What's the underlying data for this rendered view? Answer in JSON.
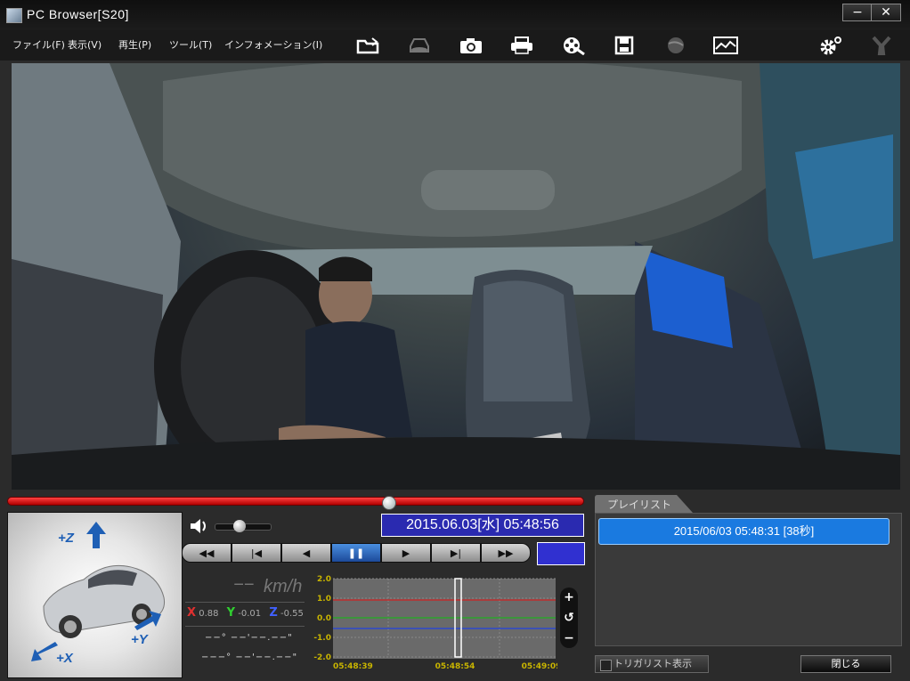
{
  "window": {
    "title": "PC Browser[S20]",
    "minimize_glyph": "−",
    "close_glyph": "✕"
  },
  "menu": [
    {
      "label": "ファイル(F)"
    },
    {
      "label": "表示(V)"
    },
    {
      "label": "再生(P)"
    },
    {
      "label": "ツール(T)"
    },
    {
      "label": "インフォメーション(I)"
    }
  ],
  "toolbar": {
    "icons": [
      "open-folder-icon",
      "disk-disabled-icon",
      "camera-icon",
      "print-icon",
      "film-search-icon",
      "save-icon",
      "globe-disabled-icon",
      "graph-export-icon",
      "settings-gear-icon",
      "tool-disabled-icon"
    ]
  },
  "sensor": {
    "z_label": "+Z",
    "y_label": "+Y",
    "x_label": "+X"
  },
  "player": {
    "datetime": "2015.06.03[水] 05:48:56",
    "seek_position": 0.66,
    "volume_level": 0.45,
    "controls": [
      {
        "name": "rewind",
        "glyph": "◀◀"
      },
      {
        "name": "prev",
        "glyph": "|◀"
      },
      {
        "name": "step-back",
        "glyph": "◀"
      },
      {
        "name": "pause",
        "glyph": "❚❚"
      },
      {
        "name": "play",
        "glyph": "▶"
      },
      {
        "name": "next",
        "glyph": "▶|"
      },
      {
        "name": "fast-forward",
        "glyph": "▶▶"
      }
    ]
  },
  "speed": {
    "value": "−−",
    "unit": "km/h"
  },
  "accel": {
    "x_label": "X",
    "x_value": "0.88",
    "y_label": "Y",
    "y_value": "-0.01",
    "z_label": "Z",
    "z_value": "-0.55"
  },
  "gps": {
    "lat": "−−° −−'−−.−−\"",
    "lon": "−−−° −−'−−.−−\""
  },
  "graph": {
    "y_ticks": [
      "2.0",
      "1.0",
      "0.0",
      "-1.0",
      "-2.0"
    ],
    "x_ticks": [
      "05:48:39",
      "05:48:54",
      "05:49:09"
    ],
    "zoom_in": "+",
    "zoom_reset": "↺",
    "zoom_out": "−"
  },
  "playlist": {
    "tab_label": "プレイリスト",
    "items": [
      {
        "label": "2015/06/03 05:48:31 [38秒]"
      }
    ]
  },
  "footer": {
    "trigger_label": "トリガリスト表示",
    "close_label": "閉じる"
  },
  "colors": {
    "accent_blue": "#1a7ae0",
    "seek_red": "#e00000",
    "graph_x": "#d02020",
    "graph_y": "#20b020",
    "graph_z": "#2040e0",
    "tick_yellow": "#c8b400"
  }
}
